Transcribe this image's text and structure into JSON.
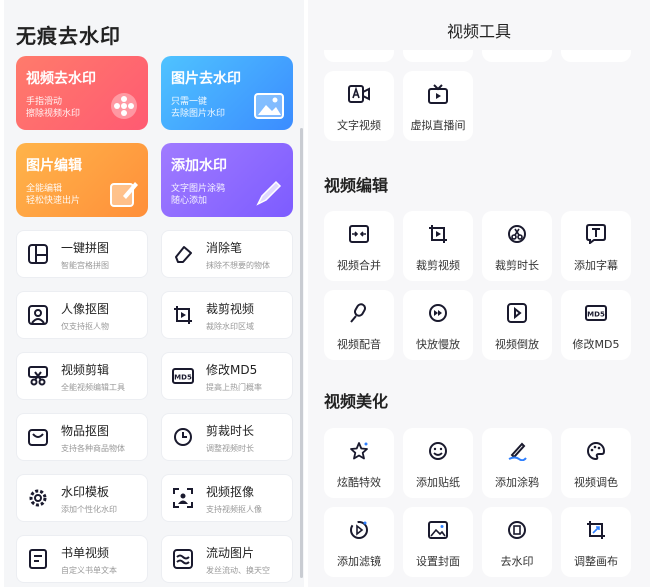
{
  "left": {
    "title": "无痕去水印",
    "features": [
      {
        "title": "视频去水印",
        "line1": "手指滑动",
        "line2": "擦除视频水印",
        "icon": "film-reel-icon"
      },
      {
        "title": "图片去水印",
        "line1": "只需一键",
        "line2": "去除图片水印",
        "icon": "image-icon"
      },
      {
        "title": "图片编辑",
        "line1": "全能编辑",
        "line2": "轻松快速出片",
        "icon": "edit-image-icon"
      },
      {
        "title": "添加水印",
        "line1": "文字图片涂鸦",
        "line2": "随心添加",
        "icon": "pen-icon"
      }
    ],
    "tools": [
      {
        "title": "一键拼图",
        "sub": "智能宫格拼图"
      },
      {
        "title": "消除笔",
        "sub": "抹除不想要的物体"
      },
      {
        "title": "人像抠图",
        "sub": "仅支持抠人物"
      },
      {
        "title": "裁剪视频",
        "sub": "裁除水印区域"
      },
      {
        "title": "视频剪辑",
        "sub": "全能视频编辑工具"
      },
      {
        "title": "修改MD5",
        "sub": "提高上热门概率"
      },
      {
        "title": "物品抠图",
        "sub": "支持各种商品物体"
      },
      {
        "title": "剪裁时长",
        "sub": "调整视频时长"
      },
      {
        "title": "水印模板",
        "sub": "添加个性化水印"
      },
      {
        "title": "视频抠像",
        "sub": "支持视频抠人像"
      },
      {
        "title": "书单视频",
        "sub": "自定义书单文本"
      },
      {
        "title": "流动图片",
        "sub": "发丝流动、换天空"
      }
    ]
  },
  "right": {
    "title": "视频工具",
    "top_items": [
      "文字视频",
      "虚拟直播间"
    ],
    "sections": [
      {
        "title": "视频编辑",
        "items": [
          "视频合并",
          "裁剪视频",
          "裁剪时长",
          "添加字幕",
          "视频配音",
          "快放慢放",
          "视频倒放",
          "修改MD5"
        ]
      },
      {
        "title": "视频美化",
        "items": [
          "炫酷特效",
          "添加贴纸",
          "添加涂鸦",
          "视频调色",
          "添加滤镜",
          "设置封面",
          "去水印",
          "调整画布"
        ]
      }
    ],
    "md5_badge": "MD5"
  },
  "colors": {
    "accent": "#1a1a2e",
    "red": "#ff6b6b",
    "blue": "#3b8cff",
    "orange": "#ff9a3c",
    "purple": "#8b63ff"
  }
}
